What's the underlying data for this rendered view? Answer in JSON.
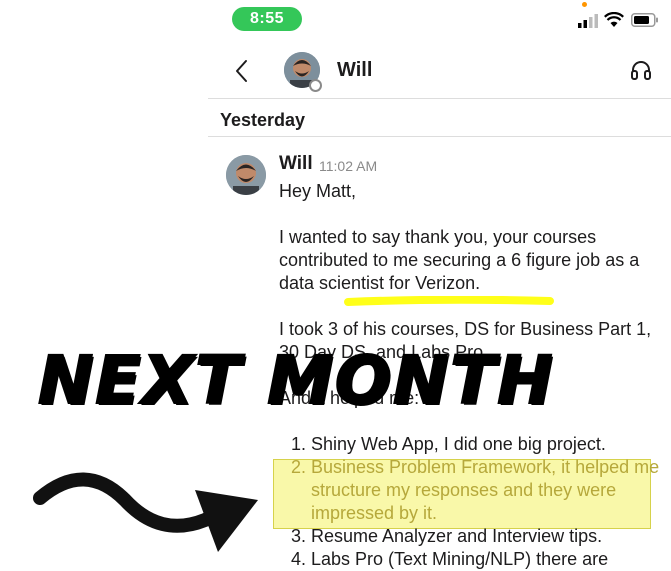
{
  "status_bar": {
    "time": "8:55"
  },
  "header": {
    "title": "Will"
  },
  "divider_label": "Yesterday",
  "message": {
    "author": "Will",
    "time": "11:02 AM",
    "paragraphs": [
      "Hey Matt,",
      "I wanted to say thank you, your courses contributed to me securing a 6 figure job as a data scientist for Verizon.",
      "I took 3 of his courses, DS for Business Part 1, 30 Day DS, and Labs Pro.",
      "And it helped me:"
    ],
    "list": [
      "Shiny Web App, I did one big project.",
      "Business Problem Framework, it helped me structure my responses and they were impressed by it.",
      "Resume Analyzer and Interview tips.",
      "Labs Pro (Text Mining/NLP) there are"
    ]
  },
  "overlay": {
    "title": "NEXT MONTH"
  },
  "colors": {
    "status_green": "#34c759",
    "highlight": "#f7f58c",
    "marker": "#ffff00"
  }
}
